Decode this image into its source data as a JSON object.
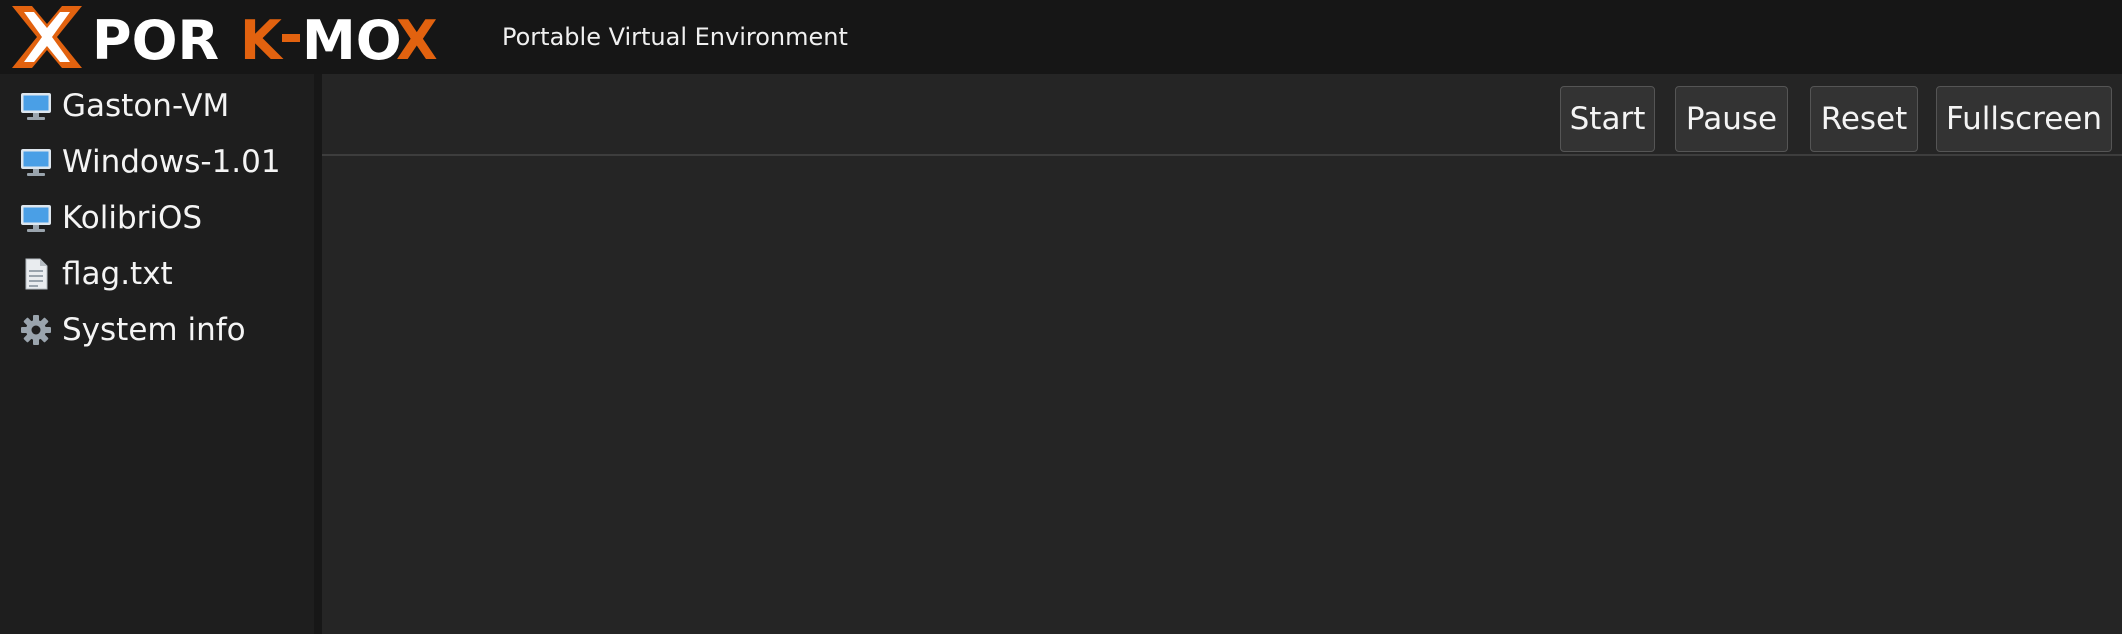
{
  "header": {
    "logo_text": "PORX-MOX",
    "subtitle": "Portable Virtual Environment",
    "colors": {
      "accent": "#e2620f",
      "logo_white": "#ffffff"
    }
  },
  "sidebar": {
    "items": [
      {
        "label": "Gaston-VM",
        "icon": "monitor-icon"
      },
      {
        "label": "Windows-1.01",
        "icon": "monitor-icon"
      },
      {
        "label": "KolibriOS",
        "icon": "monitor-icon"
      },
      {
        "label": "flag.txt",
        "icon": "document-icon"
      },
      {
        "label": "System info",
        "icon": "gear-icon"
      }
    ]
  },
  "toolbar": {
    "start_label": "Start",
    "pause_label": "Pause",
    "reset_label": "Reset",
    "fullscreen_label": "Fullscreen"
  }
}
